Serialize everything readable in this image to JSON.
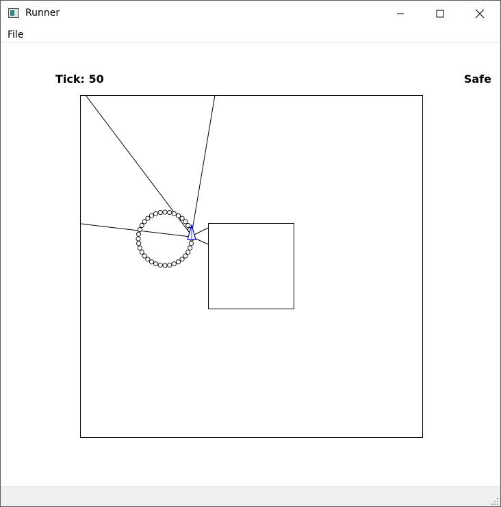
{
  "window": {
    "title": "Runner",
    "icon": "app-window-icon",
    "controls": [
      "minimize-icon",
      "maximize-icon",
      "close-icon"
    ]
  },
  "menu": {
    "file_label": "File"
  },
  "hud": {
    "tick_label": "Tick: 50",
    "status_label": "Safe"
  },
  "scene": {
    "arena_color": "#000000",
    "agent_color": "#0000ff",
    "trail_color": "#000000"
  }
}
